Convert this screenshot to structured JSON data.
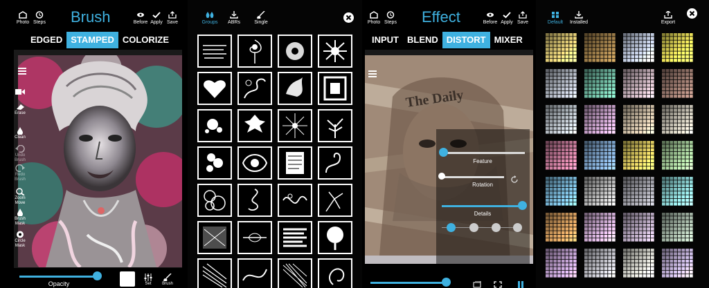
{
  "brush_panel": {
    "title": "Brush",
    "top_buttons": [
      {
        "label": "Photo",
        "icon": "photo-icon"
      },
      {
        "label": "Steps",
        "icon": "steps-icon"
      },
      {
        "label": "Before",
        "icon": "eye-icon"
      },
      {
        "label": "Apply",
        "icon": "check-icon"
      },
      {
        "label": "Save",
        "icon": "share-icon"
      }
    ],
    "tabs": [
      {
        "label": "EDGED",
        "active": false
      },
      {
        "label": "STAMPED",
        "active": true
      },
      {
        "label": "COLORIZE",
        "active": false
      }
    ],
    "tools": [
      {
        "label": "",
        "icon": "video-icon"
      },
      {
        "label": "Erase",
        "icon": "eraser-icon"
      },
      {
        "label": "Clean",
        "icon": "clean-drop-icon"
      },
      {
        "label": "Undo Brush",
        "icon": "undo-icon"
      },
      {
        "label": "Redo Brush",
        "icon": "redo-icon"
      },
      {
        "label": "Zoom Move",
        "icon": "zoom-icon"
      },
      {
        "label": "Brush Mask",
        "icon": "brush-mask-icon"
      },
      {
        "label": "Circle Mask",
        "icon": "circle-mask-icon"
      }
    ],
    "opacity_label": "Opacity",
    "opacity_value": 0.92,
    "bottom_buttons": [
      {
        "label": "Set",
        "icon": "sliders-icon"
      },
      {
        "label": "Brush",
        "icon": "brush-icon"
      }
    ],
    "accent_color": "#3fb1e0"
  },
  "abr_panel": {
    "tabs": [
      {
        "label": "Groups",
        "icon": "drops-icon",
        "active": true
      },
      {
        "label": "ABRs",
        "icon": "download-icon",
        "active": false
      },
      {
        "label": "Single",
        "icon": "single-brush-icon",
        "active": false
      }
    ],
    "close_icon": "close-icon",
    "brushes": [
      "text-scribble-brush",
      "swirl-flower-brush",
      "starburst-brush",
      "splatter-brush",
      "heart-brush",
      "vine-ornament-brush",
      "ink-splash-brush",
      "square-frame-brush",
      "splash-brush",
      "rose-spiral-brush",
      "light-burst-brush",
      "tree-brush",
      "floral-cluster-brush",
      "baroque-brush",
      "newsprint-brush",
      "curl-ornament-brush",
      "circles-brush",
      "knot-brush",
      "flourish-brush",
      "branch-brush",
      "grunge-brush",
      "divider-brush",
      "stripes-brush",
      "round-tree-brush",
      "lines-brush",
      "scroll-brush",
      "scratch-brush",
      "swirl-brush"
    ]
  },
  "effect_panel": {
    "title": "Effect",
    "top_buttons": [
      {
        "label": "Photo",
        "icon": "photo-icon"
      },
      {
        "label": "Steps",
        "icon": "steps-icon"
      },
      {
        "label": "Before",
        "icon": "eye-icon"
      },
      {
        "label": "Apply",
        "icon": "check-icon"
      },
      {
        "label": "Save",
        "icon": "share-icon"
      }
    ],
    "tabs": [
      {
        "label": "INPUT",
        "active": false
      },
      {
        "label": "BLEND",
        "active": false
      },
      {
        "label": "DISTORT",
        "active": true
      },
      {
        "label": "MIXER",
        "active": false
      }
    ],
    "sliders": [
      {
        "label": "Feature",
        "value": 0.04
      },
      {
        "label": "Rotation",
        "value": 0.04
      },
      {
        "label": "Details",
        "value": 1.0
      }
    ],
    "detail_steps": 4,
    "detail_selected": 1,
    "bottom_slider_value": 0.95,
    "photo_text": "The Daily"
  },
  "mixer_panel": {
    "tabs": [
      {
        "label": "Default",
        "icon": "grid-icon",
        "active": true
      },
      {
        "label": "Installed",
        "icon": "download-icon",
        "active": false
      },
      {
        "label": "Export",
        "icon": "export-icon",
        "active": false
      }
    ],
    "close_icon": "close-icon",
    "palettes": [
      [
        "#e8d27a",
        "#9e7e4a",
        "#c7d1e6",
        "#f2e75c"
      ],
      [
        "#b0b6c1",
        "#6fb8a0",
        "#c6b0ba",
        "#9b7a6f"
      ],
      [
        "#b9c1c8",
        "#c6a0c8",
        "#d0c0a8",
        "#c9c4b6"
      ],
      [
        "#c87c9c",
        "#7fa5cc",
        "#e2cf63",
        "#a7cf9c"
      ],
      [
        "#7ab8d8",
        "#b8b8b8",
        "#a0a0a8",
        "#8fd8d8"
      ],
      [
        "#d8a060",
        "#d3b0d8",
        "#b8a8c0",
        "#a6b8a8"
      ],
      [
        "#c0a0d0",
        "#c0c0c8",
        "#d8d8d0",
        "#c8b8e0"
      ]
    ]
  }
}
